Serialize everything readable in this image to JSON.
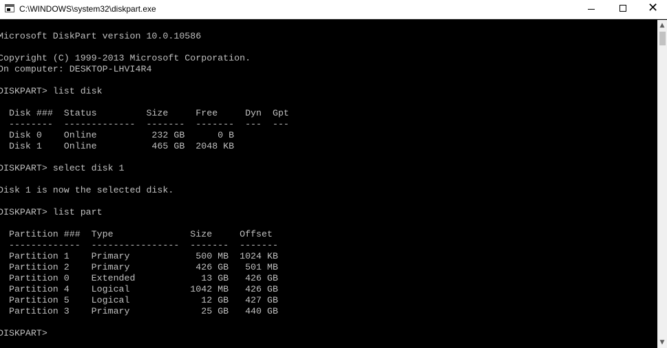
{
  "window": {
    "title": "C:\\WINDOWS\\system32\\diskpart.exe",
    "minimize_glyph": "",
    "close_glyph": "✕"
  },
  "console": {
    "lines": [
      "Microsoft DiskPart version 10.0.10586",
      "",
      "Copyright (C) 1999-2013 Microsoft Corporation.",
      "On computer: DESKTOP-LHVI4R4",
      "",
      "DISKPART> list disk",
      "",
      "  Disk ###  Status         Size     Free     Dyn  Gpt",
      "  --------  -------------  -------  -------  ---  ---",
      "  Disk 0    Online          232 GB      0 B",
      "  Disk 1    Online          465 GB  2048 KB",
      "",
      "DISKPART> select disk 1",
      "",
      "Disk 1 is now the selected disk.",
      "",
      "DISKPART> list part",
      "",
      "  Partition ###  Type              Size     Offset",
      "  -------------  ----------------  -------  -------",
      "  Partition 1    Primary            500 MB  1024 KB",
      "  Partition 2    Primary            426 GB   501 MB",
      "  Partition 0    Extended            13 GB   426 GB",
      "  Partition 4    Logical           1042 MB   426 GB",
      "  Partition 5    Logical             12 GB   427 GB",
      "  Partition 3    Primary             25 GB   440 GB",
      "",
      "DISKPART> "
    ]
  },
  "scrollbar": {
    "up_glyph": "▲",
    "down_glyph": "▼"
  },
  "colors": {
    "console_bg": "#000000",
    "console_fg": "#c0c0c0",
    "titlebar_bg": "#ffffff"
  }
}
